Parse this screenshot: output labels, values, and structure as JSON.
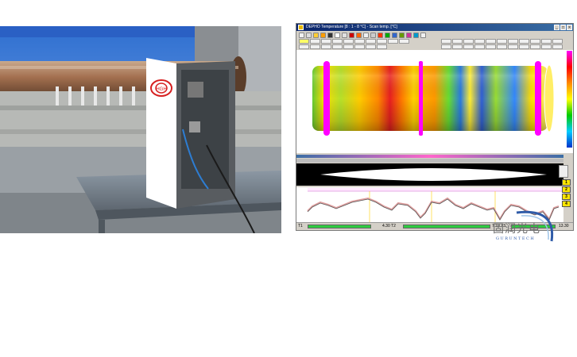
{
  "app": {
    "title": "DEPHO Temperature [8 : 1 - 8 °C] - Scan temp. [°C]",
    "status_left": "T1",
    "status_mid": "4.30  T2",
    "status_right": "7.10  T3",
    "status_time": "13.30"
  },
  "side_buttons": [
    "1",
    "2",
    "3",
    "4"
  ],
  "watermark": {
    "chinese": "固润光电",
    "english": "GURUNTECH"
  },
  "photo": {
    "logo_text": "HGH"
  },
  "colors": {
    "title_bar": "#0a246a",
    "status_green": "#2ecc40",
    "side_button": "#ffe600",
    "marker": "#ff00ff"
  }
}
